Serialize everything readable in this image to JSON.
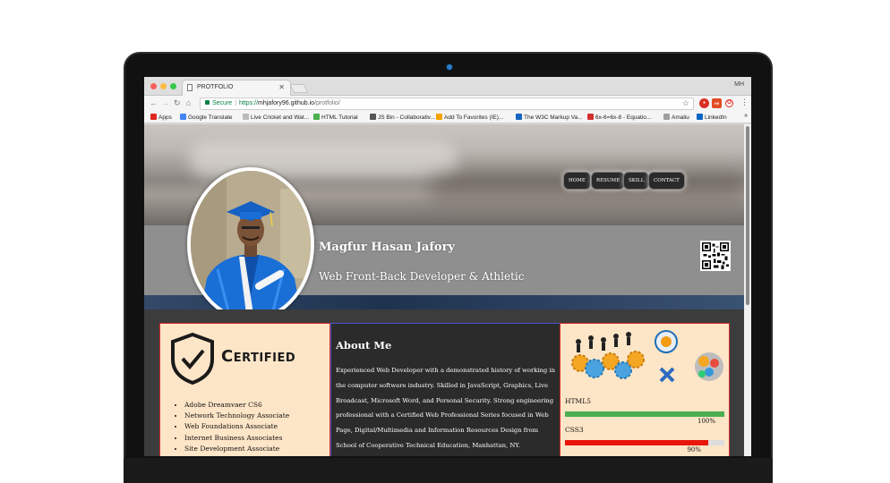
{
  "browser": {
    "window_initials": "MH",
    "tab": {
      "title": "PROTFOLIO"
    },
    "address": {
      "secure_label": "Secure",
      "scheme": "https://",
      "host": "mhjafory96.github.io",
      "path": "/protfolio/"
    },
    "bookmarks": [
      {
        "label": "Apps",
        "color": "#e0271f"
      },
      {
        "label": "Google Translate",
        "color": "#4285f4"
      },
      {
        "label": "Live Cricket and Wat...",
        "color": "#bbbbbb"
      },
      {
        "label": "HTML Tutorial",
        "color": "#4caf50"
      },
      {
        "label": "JS Bin - Collaborativ...",
        "color": "#555555"
      },
      {
        "label": "Add To Favorites (IE)...",
        "color": "#f4a300"
      },
      {
        "label": "The W3C Markup Va...",
        "color": "#1565c0"
      },
      {
        "label": "6x-6=6x-8 - Equatio...",
        "color": "#d32f2f"
      },
      {
        "label": "Amaliu",
        "color": "#9e9e9e"
      },
      {
        "label": "LinkedIn",
        "color": "#0a66c2"
      }
    ],
    "bookmarks_more": "»"
  },
  "site": {
    "nav": [
      "HOME",
      "RESUME",
      "SKILL",
      "CONTACT"
    ],
    "profile": {
      "name": "Magfur Hasan Jafory",
      "tagline": "Web Front-Back Developer & Athletic"
    },
    "certified": {
      "badge_text": "Certified",
      "items": [
        "Adobe Dreamvaer CS6",
        "Network Technology Associate",
        "Web Foundations Associate",
        "Internet Business Associates",
        "Site Development Associate"
      ]
    },
    "about": {
      "title": "About Me",
      "text": "Experienced Web Developer with a demonstrated history of working in the computer software industry. Skilled in JavaScript, Graphics, Live Broadcast, Microsoft Word, and Personal Security. Strong engineering professional with a Certified Web Professional Series focused in Web Page, Digital/Multimedia and Information Resources Design from School of Cooperative Technical Education, Manhattan, NY."
    },
    "skills": [
      {
        "name": "HTML5",
        "percent_label": "100%",
        "level": 1.0,
        "color": "#4caf50"
      },
      {
        "name": "CSS3",
        "percent_label": "90%",
        "level": 0.9,
        "color": "#e8160c"
      }
    ]
  }
}
